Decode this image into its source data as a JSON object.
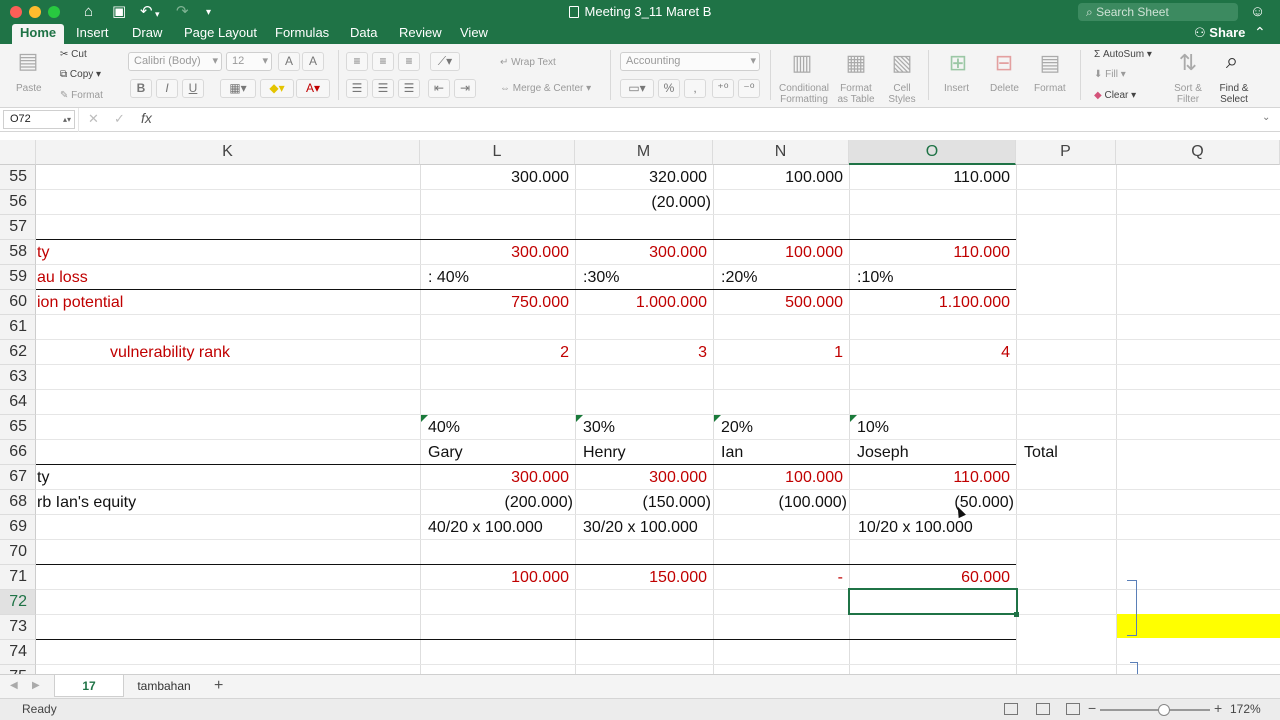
{
  "window": {
    "title": "Meeting 3_11 Maret B",
    "search_placeholder": "Search Sheet",
    "share_label": "Share"
  },
  "tabs": [
    "Home",
    "Insert",
    "Draw",
    "Page Layout",
    "Formulas",
    "Data",
    "Review",
    "View"
  ],
  "ribbon": {
    "paste": "Paste",
    "cut": "Cut",
    "copy": "Copy",
    "format": "Format",
    "font_name": "Calibri (Body)",
    "font_size": "12",
    "wrap_text": "Wrap Text",
    "merge_center": "Merge & Center",
    "number_format": "Accounting",
    "conditional_formatting": [
      "Conditional",
      "Formatting"
    ],
    "format_as_table": [
      "Format",
      "as Table"
    ],
    "cell_styles": [
      "Cell",
      "Styles"
    ],
    "insert": "Insert",
    "delete": "Delete",
    "format_cells": "Format",
    "autosum": "AutoSum",
    "fill": "Fill",
    "clear": "Clear",
    "sort_filter": [
      "Sort &",
      "Filter"
    ],
    "find_select": [
      "Find &",
      "Select"
    ],
    "bold": "B",
    "italic": "I",
    "underline": "U"
  },
  "formula_bar": {
    "name_box": "O72",
    "fx": "fx",
    "formula": ""
  },
  "columns": [
    "K",
    "L",
    "M",
    "N",
    "O",
    "P",
    "Q"
  ],
  "rows": [
    "55",
    "56",
    "57",
    "58",
    "59",
    "60",
    "61",
    "62",
    "63",
    "64",
    "65",
    "66",
    "67",
    "68",
    "69",
    "70",
    "71",
    "72",
    "73",
    "74",
    "75"
  ],
  "cells": {
    "r55": {
      "L": "300.000",
      "M": "320.000",
      "N": "100.000",
      "O": "110.000"
    },
    "r56": {
      "M": "(20.000)"
    },
    "r58": {
      "K": "ty",
      "L": "300.000",
      "M": "300.000",
      "N": "100.000",
      "O": "110.000"
    },
    "r59": {
      "K": "au loss",
      "L": ": 40%",
      "M": ":30%",
      "N": ":20%",
      "O": ":10%"
    },
    "r60": {
      "K": "ion potential",
      "L": "750.000",
      "M": "1.000.000",
      "N": "500.000",
      "O": "1.100.000"
    },
    "r62": {
      "K": "vulnerability rank",
      "L": "2",
      "M": "3",
      "N": "1",
      "O": "4"
    },
    "r65": {
      "L": "40%",
      "M": "30%",
      "N": "20%",
      "O": "10%"
    },
    "r66": {
      "L": "Gary",
      "M": "Henry",
      "N": "Ian",
      "O": "Joseph",
      "P": "Total"
    },
    "r67": {
      "K": "ty",
      "L": "300.000",
      "M": "300.000",
      "N": "100.000",
      "O": "110.000"
    },
    "r68": {
      "K": "rb Ian's equity",
      "L": "(200.000)",
      "M": "(150.000)",
      "N": "(100.000)",
      "O": "(50.000)"
    },
    "r69": {
      "L": "40/20 x 100.000",
      "M": "30/20 x 100.000",
      "O": "10/20 x 100.000"
    },
    "r71": {
      "L": "100.000",
      "M": "150.000",
      "N": "-",
      "O": "60.000"
    }
  },
  "sheets": [
    "17",
    "tambahan"
  ],
  "status": {
    "ready": "Ready",
    "zoom": "172%"
  },
  "colors": {
    "excel_green": "#1f7346",
    "red_text": "#c00000",
    "highlight_yellow": "#ffff00"
  }
}
